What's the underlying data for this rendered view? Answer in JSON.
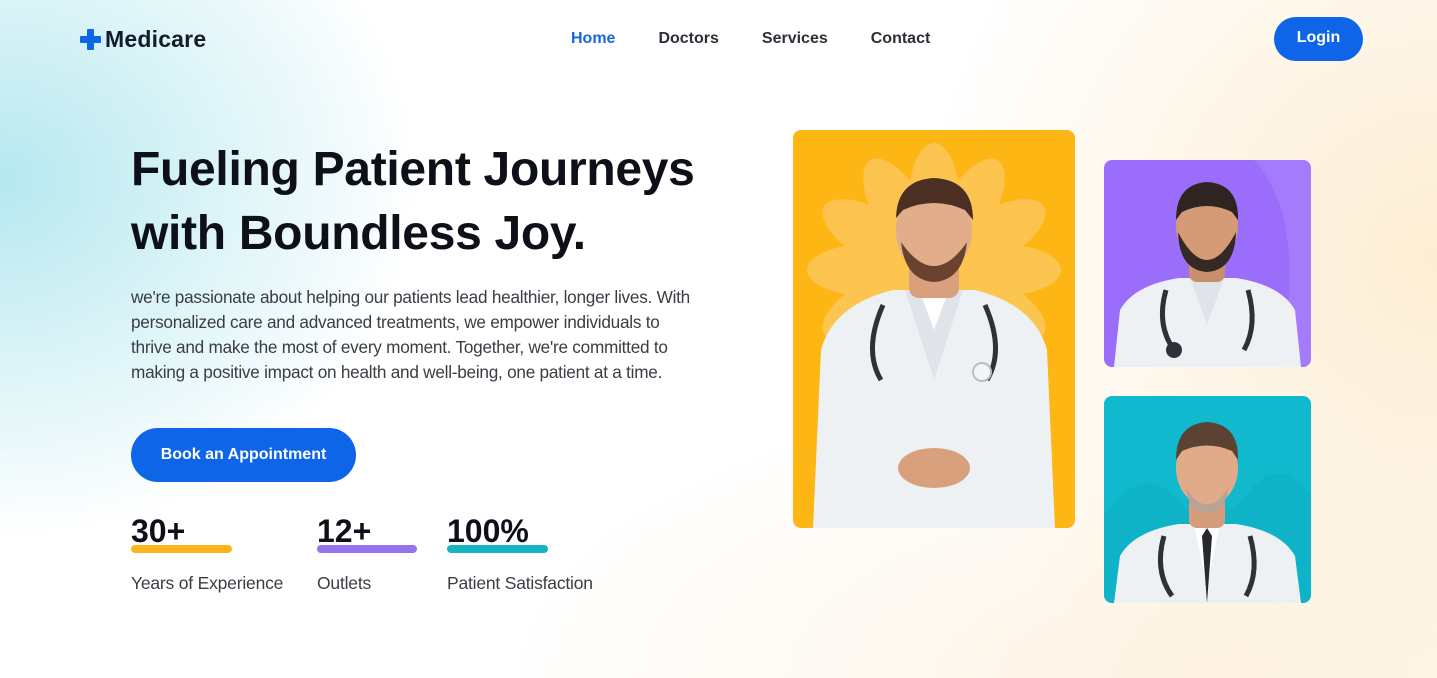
{
  "header": {
    "logo_text": "Medicare",
    "nav": [
      "Home",
      "Doctors",
      "Services",
      "Contact"
    ],
    "active_nav": "Home",
    "login_label": "Login"
  },
  "hero": {
    "title_line1": "Fueling Patient Journeys",
    "title_line2": "with Boundless Joy.",
    "description": "we're passionate about helping our patients lead healthier, longer lives. With personalized care and advanced treatments, we empower individuals to thrive and make the most of every moment. Together, we're committed to making a positive impact on health and well-being, one patient at a time.",
    "cta_label": "Book an Appointment"
  },
  "stats": [
    {
      "value": "30+",
      "label": "Years of Experience",
      "accent": "#fbb41b"
    },
    {
      "value": "12+",
      "label": "Outlets",
      "accent": "#9673ea"
    },
    {
      "value": "100%",
      "label": "Patient Satisfaction",
      "accent": "#17b3c2"
    }
  ],
  "doctor_cards": [
    {
      "name": "doctor-photo-main",
      "background": "#fdb614",
      "icon": "doctor-with-stethoscope"
    },
    {
      "name": "doctor-photo-top",
      "background": "#9a6dfa",
      "icon": "doctor-with-stethoscope"
    },
    {
      "name": "doctor-photo-bottom",
      "background": "#10b9cd",
      "icon": "doctor-with-stethoscope"
    }
  ],
  "colors": {
    "primary": "#0f65e8",
    "nav_active": "#1a66d6",
    "heading": "#0d1018"
  }
}
